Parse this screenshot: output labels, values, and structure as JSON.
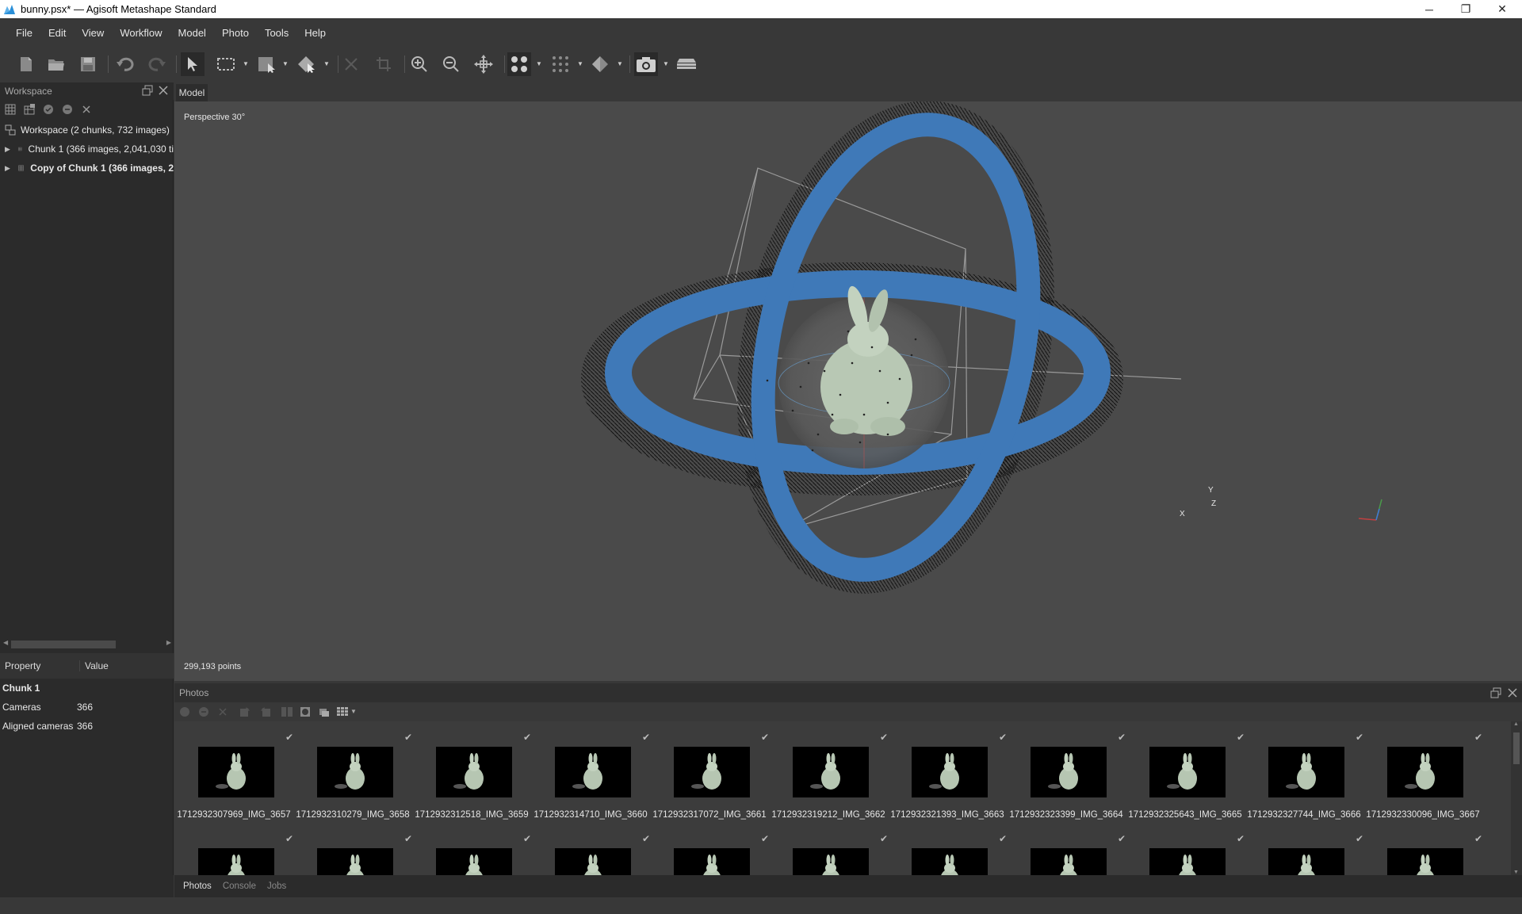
{
  "window": {
    "title": "bunny.psx* — Agisoft Metashape Standard",
    "minimize_glyph": "─",
    "maximize_glyph": "❐",
    "close_glyph": "✕"
  },
  "menu": {
    "file": "File",
    "edit": "Edit",
    "view": "View",
    "workflow": "Workflow",
    "model": "Model",
    "photo": "Photo",
    "tools": "Tools",
    "help": "Help"
  },
  "workspace": {
    "panel_title": "Workspace",
    "root": "Workspace (2 chunks, 732 images)",
    "chunks": [
      {
        "label": "Chunk 1 (366 images, 2,041,030 ti"
      },
      {
        "label": "Copy of Chunk 1 (366 images, 2"
      }
    ]
  },
  "properties": {
    "col_property": "Property",
    "col_value": "Value",
    "section": "Chunk 1",
    "rows": [
      {
        "name": "Cameras",
        "value": "366"
      },
      {
        "name": "Aligned cameras",
        "value": "366"
      }
    ]
  },
  "model_view": {
    "tab": "Model",
    "projection": "Perspective 30°",
    "points": "299,193 points",
    "axis_x": "X",
    "axis_y": "Y",
    "axis_z": "Z"
  },
  "photos": {
    "panel_title": "Photos",
    "captions": [
      "1712932307969_IMG_3657",
      "1712932310279_IMG_3658",
      "1712932312518_IMG_3659",
      "1712932314710_IMG_3660",
      "1712932317072_IMG_3661",
      "1712932319212_IMG_3662",
      "1712932321393_IMG_3663",
      "1712932323399_IMG_3664",
      "1712932325643_IMG_3665",
      "1712932327744_IMG_3666",
      "1712932330096_IMG_3667"
    ],
    "check_glyph": "✔"
  },
  "bottom_tabs": {
    "photos": "Photos",
    "console": "Console",
    "jobs": "Jobs"
  },
  "colors": {
    "background": "#383838",
    "viewport": "#4a4a4a",
    "camera_ring": "#3f79b8",
    "panel": "#2b2b2b"
  }
}
